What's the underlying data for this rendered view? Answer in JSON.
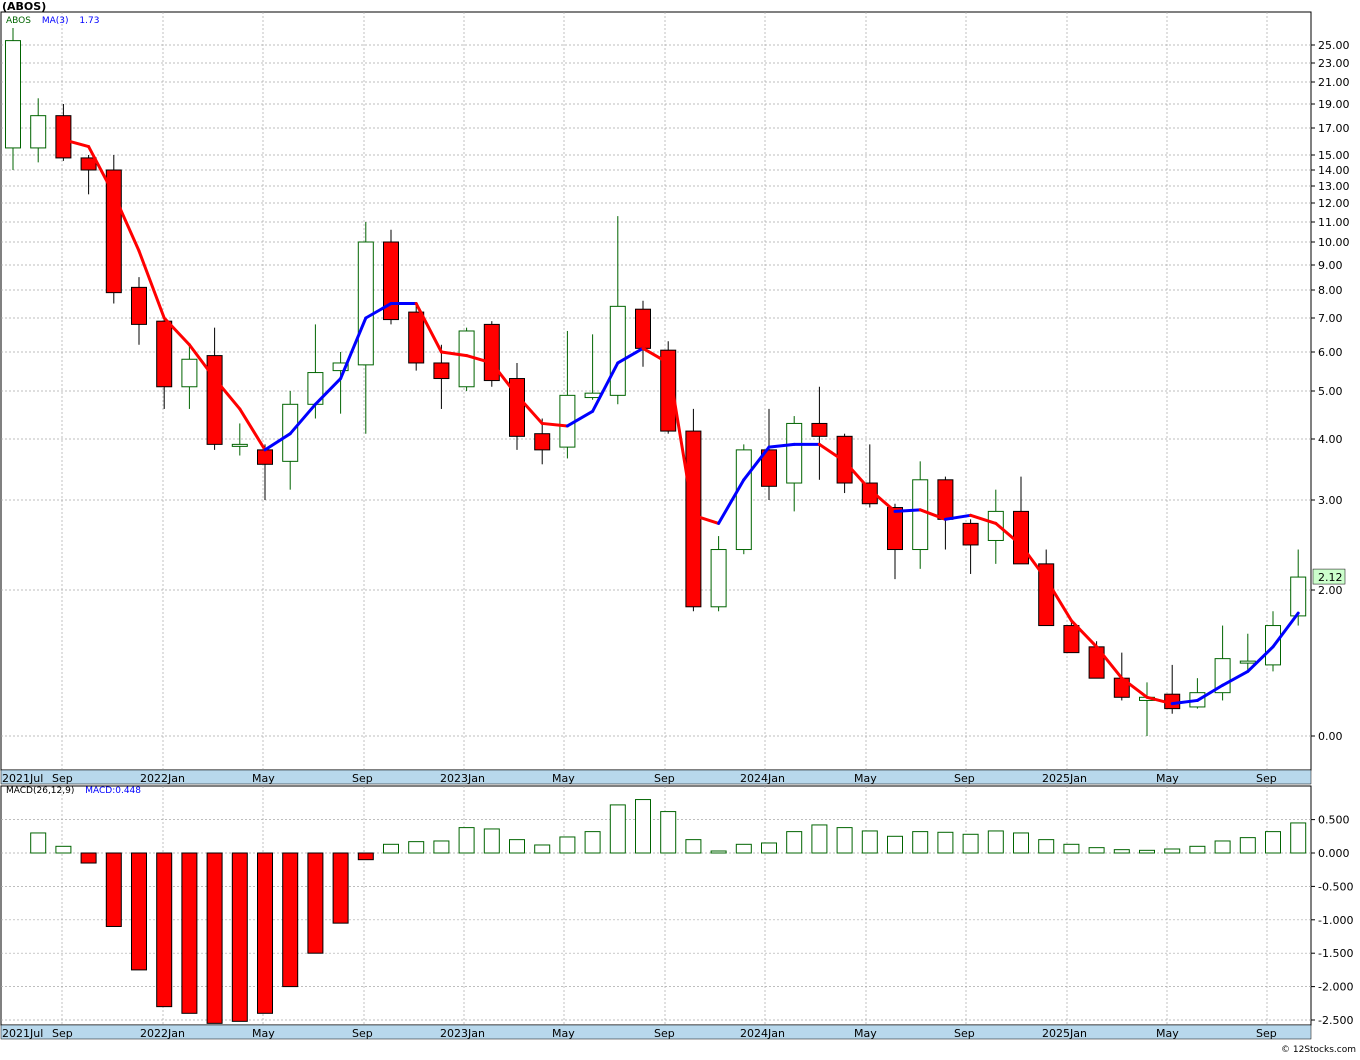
{
  "header": {
    "title": "(ABOS)",
    "legend_symbol": "ABOS",
    "legend_ma": "MA(3)",
    "legend_ma_value": "1.73",
    "macd_label": "MACD(26,12,9)",
    "macd_value": "MACD:0.448",
    "copyright": "© 12Stocks.com"
  },
  "colors": {
    "up": "#006400",
    "down": "#ff0000",
    "ma_up": "#0000ff",
    "ma_down": "#ff0000",
    "grid": "#a8a8a8",
    "axis_band": "#b8d8ec",
    "last_price_box": "#ccffcc"
  },
  "chart_data": [
    {
      "type": "candlestick",
      "title": "(ABOS)",
      "y_scale": "log",
      "y_ticks": [
        "0.00",
        "2.00",
        "3.00",
        "4.00",
        "5.00",
        "6.00",
        "7.00",
        "8.00",
        "9.00",
        "10.00",
        "11.00",
        "12.00",
        "13.00",
        "14.00",
        "15.00",
        "17.00",
        "19.00",
        "21.00",
        "23.00",
        "25.00"
      ],
      "x_labels": [
        "2021Jul",
        "Sep",
        "2022Jan",
        "May",
        "Sep",
        "2023Jan",
        "May",
        "Sep",
        "2024Jan",
        "May",
        "Sep",
        "2025Jan",
        "May",
        "Sep"
      ],
      "last_price_label": "2.12",
      "candles": [
        {
          "o": 15.5,
          "h": 27,
          "l": 14,
          "c": 25.5
        },
        {
          "o": 15.5,
          "h": 19.5,
          "l": 14.5,
          "c": 18
        },
        {
          "o": 18,
          "h": 19,
          "l": 14.6,
          "c": 14.8
        },
        {
          "o": 14.8,
          "h": 15,
          "l": 12.5,
          "c": 14
        },
        {
          "o": 14,
          "h": 15,
          "l": 7.5,
          "c": 7.9
        },
        {
          "o": 8.1,
          "h": 8.5,
          "l": 6.2,
          "c": 6.8
        },
        {
          "o": 6.9,
          "h": 7,
          "l": 4.6,
          "c": 5.1
        },
        {
          "o": 5.1,
          "h": 6.2,
          "l": 4.6,
          "c": 5.8
        },
        {
          "o": 5.9,
          "h": 6.7,
          "l": 3.8,
          "c": 3.9
        },
        {
          "o": 3.9,
          "h": 4.3,
          "l": 3.7,
          "c": 3.9
        },
        {
          "o": 3.8,
          "h": 3.9,
          "l": 3.0,
          "c": 3.55
        },
        {
          "o": 3.6,
          "h": 5.0,
          "l": 3.15,
          "c": 4.7
        },
        {
          "o": 4.7,
          "h": 6.8,
          "l": 4.4,
          "c": 5.45
        },
        {
          "o": 5.5,
          "h": 6.0,
          "l": 4.5,
          "c": 5.7
        },
        {
          "o": 5.65,
          "h": 11,
          "l": 4.1,
          "c": 10
        },
        {
          "o": 10,
          "h": 10.6,
          "l": 6.8,
          "c": 6.95
        },
        {
          "o": 7.2,
          "h": 7.5,
          "l": 5.5,
          "c": 5.7
        },
        {
          "o": 5.7,
          "h": 6.2,
          "l": 4.6,
          "c": 5.3
        },
        {
          "o": 5.1,
          "h": 6.7,
          "l": 5.0,
          "c": 6.6
        },
        {
          "o": 6.8,
          "h": 6.9,
          "l": 5.1,
          "c": 5.25
        },
        {
          "o": 5.3,
          "h": 5.7,
          "l": 3.8,
          "c": 4.05
        },
        {
          "o": 4.1,
          "h": 4.4,
          "l": 3.55,
          "c": 3.8
        },
        {
          "o": 3.85,
          "h": 6.6,
          "l": 3.65,
          "c": 4.9
        },
        {
          "o": 4.85,
          "h": 6.5,
          "l": 4.8,
          "c": 4.95
        },
        {
          "o": 4.9,
          "h": 11.3,
          "l": 4.7,
          "c": 7.4
        },
        {
          "o": 7.3,
          "h": 7.6,
          "l": 5.6,
          "c": 6.1
        },
        {
          "o": 6.05,
          "h": 6.3,
          "l": 4.1,
          "c": 4.15
        },
        {
          "o": 4.15,
          "h": 4.6,
          "l": 1.75,
          "c": 1.8
        },
        {
          "o": 1.8,
          "h": 2.55,
          "l": 1.75,
          "c": 2.4
        },
        {
          "o": 2.4,
          "h": 3.9,
          "l": 2.35,
          "c": 3.8
        },
        {
          "o": 3.8,
          "h": 4.6,
          "l": 3.0,
          "c": 3.2
        },
        {
          "o": 3.25,
          "h": 4.45,
          "l": 2.85,
          "c": 4.3
        },
        {
          "o": 4.3,
          "h": 5.1,
          "l": 3.3,
          "c": 4.05
        },
        {
          "o": 4.05,
          "h": 4.1,
          "l": 3.1,
          "c": 3.25
        },
        {
          "o": 3.25,
          "h": 3.9,
          "l": 2.9,
          "c": 2.95
        },
        {
          "o": 2.9,
          "h": 2.95,
          "l": 2.1,
          "c": 2.4
        },
        {
          "o": 2.4,
          "h": 3.6,
          "l": 2.2,
          "c": 3.3
        },
        {
          "o": 3.3,
          "h": 3.35,
          "l": 2.4,
          "c": 2.75
        },
        {
          "o": 2.7,
          "h": 2.75,
          "l": 2.15,
          "c": 2.45
        },
        {
          "o": 2.5,
          "h": 3.15,
          "l": 2.25,
          "c": 2.85
        },
        {
          "o": 2.85,
          "h": 3.35,
          "l": 2.25,
          "c": 2.25
        },
        {
          "o": 2.25,
          "h": 2.4,
          "l": 1.6,
          "c": 1.6
        },
        {
          "o": 1.6,
          "h": 1.65,
          "l": 1.35,
          "c": 1.35
        },
        {
          "o": 1.4,
          "h": 1.45,
          "l": 1.15,
          "c": 1.15
        },
        {
          "o": 1.15,
          "h": 1.35,
          "l": 1.0,
          "c": 1.02
        },
        {
          "o": 1.0,
          "h": 1.12,
          "l": 0.8,
          "c": 1.02
        },
        {
          "o": 1.04,
          "h": 1.25,
          "l": 0.92,
          "c": 0.95
        },
        {
          "o": 0.96,
          "h": 1.15,
          "l": 0.95,
          "c": 1.05
        },
        {
          "o": 1.05,
          "h": 1.6,
          "l": 1.0,
          "c": 1.3
        },
        {
          "o": 1.28,
          "h": 1.52,
          "l": 1.2,
          "c": 1.28
        },
        {
          "o": 1.25,
          "h": 1.75,
          "l": 1.2,
          "c": 1.6
        },
        {
          "o": 1.7,
          "h": 2.4,
          "l": 1.6,
          "c": 2.12
        }
      ],
      "ma3": [
        null,
        null,
        16.1,
        15.6,
        12.5,
        9.6,
        7.0,
        6.2,
        5.3,
        4.6,
        3.8,
        4.1,
        4.7,
        5.3,
        7.0,
        7.5,
        7.5,
        6.0,
        5.9,
        5.7,
        4.9,
        4.3,
        4.25,
        4.55,
        5.7,
        6.1,
        5.7,
        2.8,
        2.7,
        3.3,
        3.85,
        3.9,
        3.9,
        3.6,
        3.15,
        2.85,
        2.87,
        2.75,
        2.8,
        2.7,
        2.45,
        2.1,
        1.65,
        1.4,
        1.15,
        1.02,
        0.98,
        1.0,
        1.1,
        1.2,
        1.4,
        1.73
      ]
    },
    {
      "type": "bar",
      "title": "MACD(26,12,9)",
      "y_ticks": [
        "0.500",
        "0.000",
        "-0.500",
        "-1.000",
        "-1.500",
        "-2.000",
        "-2.500"
      ],
      "values": [
        0.3,
        0.1,
        -0.15,
        -1.1,
        -1.75,
        -2.3,
        -2.4,
        -2.55,
        -2.52,
        -2.4,
        -2.0,
        -1.5,
        -1.05,
        -0.1,
        0.13,
        0.17,
        0.18,
        0.38,
        0.36,
        0.2,
        0.12,
        0.24,
        0.32,
        0.72,
        0.8,
        0.62,
        0.2,
        0.03,
        0.13,
        0.15,
        0.32,
        0.42,
        0.38,
        0.33,
        0.25,
        0.32,
        0.31,
        0.28,
        0.33,
        0.3,
        0.2,
        0.13,
        0.08,
        0.05,
        0.04,
        0.06,
        0.1,
        0.18,
        0.23,
        0.32,
        0.45
      ]
    }
  ]
}
